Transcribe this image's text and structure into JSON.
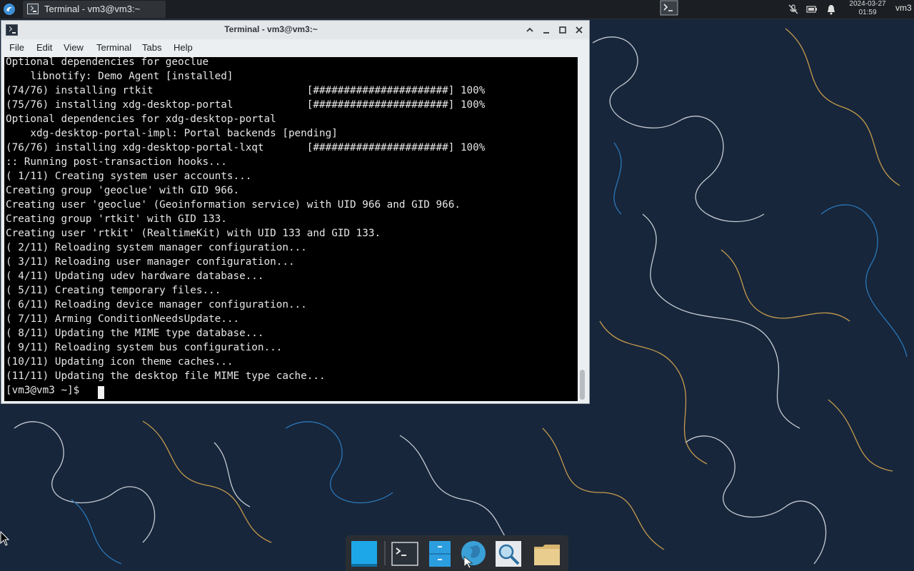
{
  "panel": {
    "taskbar_title": "Terminal - vm3@vm3:~",
    "clock_date": "2024-03-27",
    "clock_time": "01:59",
    "user": "vm3",
    "icons": [
      "start-menu-icon",
      "terminal-icon",
      "show-desktop-icon",
      "mic-muted-icon",
      "battery-icon",
      "notifications-icon"
    ]
  },
  "window": {
    "title": "Terminal - vm3@vm3:~",
    "buttons": [
      "maximize-up-icon",
      "minimize-icon",
      "restore-icon",
      "close-icon"
    ]
  },
  "menu": [
    "File",
    "Edit",
    "View",
    "Terminal",
    "Tabs",
    "Help"
  ],
  "terminal": {
    "lines": [
      "Optional dependencies for geoclue",
      "    libnotify: Demo Agent [installed]",
      "(74/76) installing rtkit                         [######################] 100%",
      "(75/76) installing xdg-desktop-portal            [######################] 100%",
      "Optional dependencies for xdg-desktop-portal",
      "    xdg-desktop-portal-impl: Portal backends [pending]",
      "(76/76) installing xdg-desktop-portal-lxqt       [######################] 100%",
      ":: Running post-transaction hooks...",
      "( 1/11) Creating system user accounts...",
      "Creating group 'geoclue' with GID 966.",
      "Creating user 'geoclue' (Geoinformation service) with UID 966 and GID 966.",
      "Creating group 'rtkit' with GID 133.",
      "Creating user 'rtkit' (RealtimeKit) with UID 133 and GID 133.",
      "( 2/11) Reloading system manager configuration...",
      "( 3/11) Reloading user manager configuration...",
      "( 4/11) Updating udev hardware database...",
      "( 5/11) Creating temporary files...",
      "( 6/11) Reloading device manager configuration...",
      "( 7/11) Arming ConditionNeedsUpdate...",
      "( 8/11) Updating the MIME type database...",
      "( 9/11) Reloading system bus configuration...",
      "(10/11) Updating icon theme caches...",
      "(11/11) Updating the desktop file MIME type cache...",
      "[vm3@vm3 ~]$ "
    ]
  },
  "dock": {
    "items": [
      "desktop-icon",
      "terminal-icon",
      "file-cabinet-icon",
      "web-browser-icon",
      "search-icon",
      "folder-icon"
    ]
  },
  "colors": {
    "wallpaper": "#17263b",
    "panel": "#1b1e22",
    "terminal_bg": "#000000",
    "terminal_fg": "#e6e6e6"
  }
}
